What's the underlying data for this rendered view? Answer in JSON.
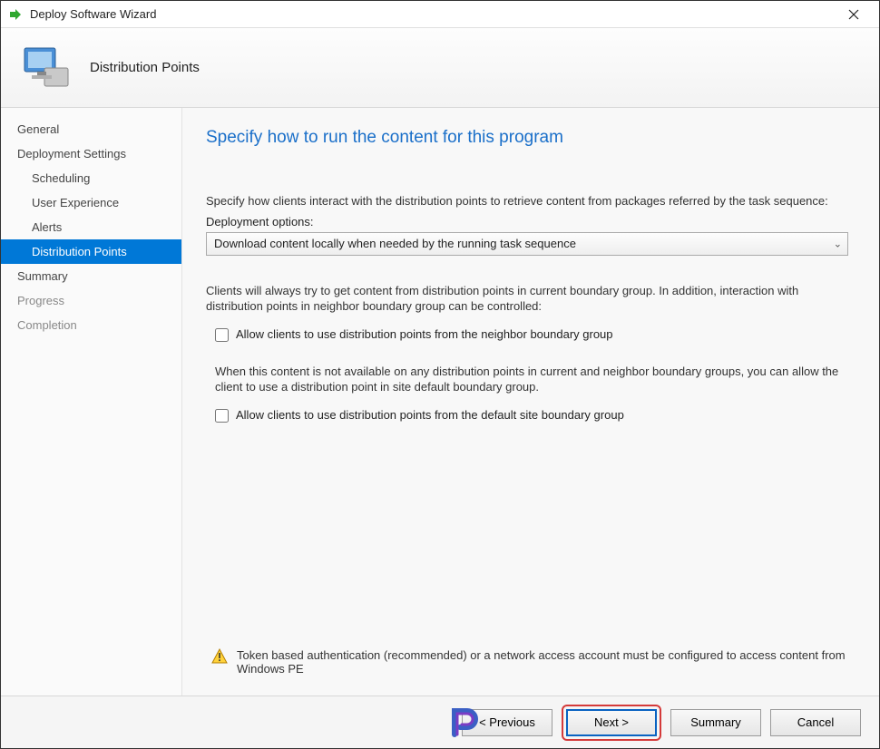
{
  "titlebar": {
    "title": "Deploy Software Wizard"
  },
  "header": {
    "step_title": "Distribution Points"
  },
  "sidebar": {
    "items": [
      {
        "label": "General",
        "child": false,
        "active": false,
        "muted": false
      },
      {
        "label": "Deployment Settings",
        "child": false,
        "active": false,
        "muted": false
      },
      {
        "label": "Scheduling",
        "child": true,
        "active": false,
        "muted": false
      },
      {
        "label": "User Experience",
        "child": true,
        "active": false,
        "muted": false
      },
      {
        "label": "Alerts",
        "child": true,
        "active": false,
        "muted": false
      },
      {
        "label": "Distribution Points",
        "child": true,
        "active": true,
        "muted": false
      },
      {
        "label": "Summary",
        "child": false,
        "active": false,
        "muted": false
      },
      {
        "label": "Progress",
        "child": false,
        "active": false,
        "muted": true
      },
      {
        "label": "Completion",
        "child": false,
        "active": false,
        "muted": true
      }
    ]
  },
  "content": {
    "heading": "Specify how to run the content for this program",
    "desc1": "Specify how clients interact with the distribution points to retrieve content from packages referred by the task sequence:",
    "dropdown_label": "Deployment options:",
    "dropdown_value": "Download content locally when needed by the running task sequence",
    "desc2": "Clients will always try to get content from distribution points in current boundary group. In addition, interaction with distribution points in neighbor boundary group can be controlled:",
    "check1_label": "Allow clients to use distribution points from the neighbor boundary group",
    "desc3": "When this content is not available on any distribution points in current and neighbor boundary groups, you can allow the client to use a distribution point in site default boundary group.",
    "check2_label": "Allow clients to use distribution points from the default site boundary group",
    "warning": "Token based authentication (recommended) or a network access account must be configured to access content from Windows PE"
  },
  "footer": {
    "previous": "< Previous",
    "next": "Next >",
    "summary": "Summary",
    "cancel": "Cancel"
  }
}
